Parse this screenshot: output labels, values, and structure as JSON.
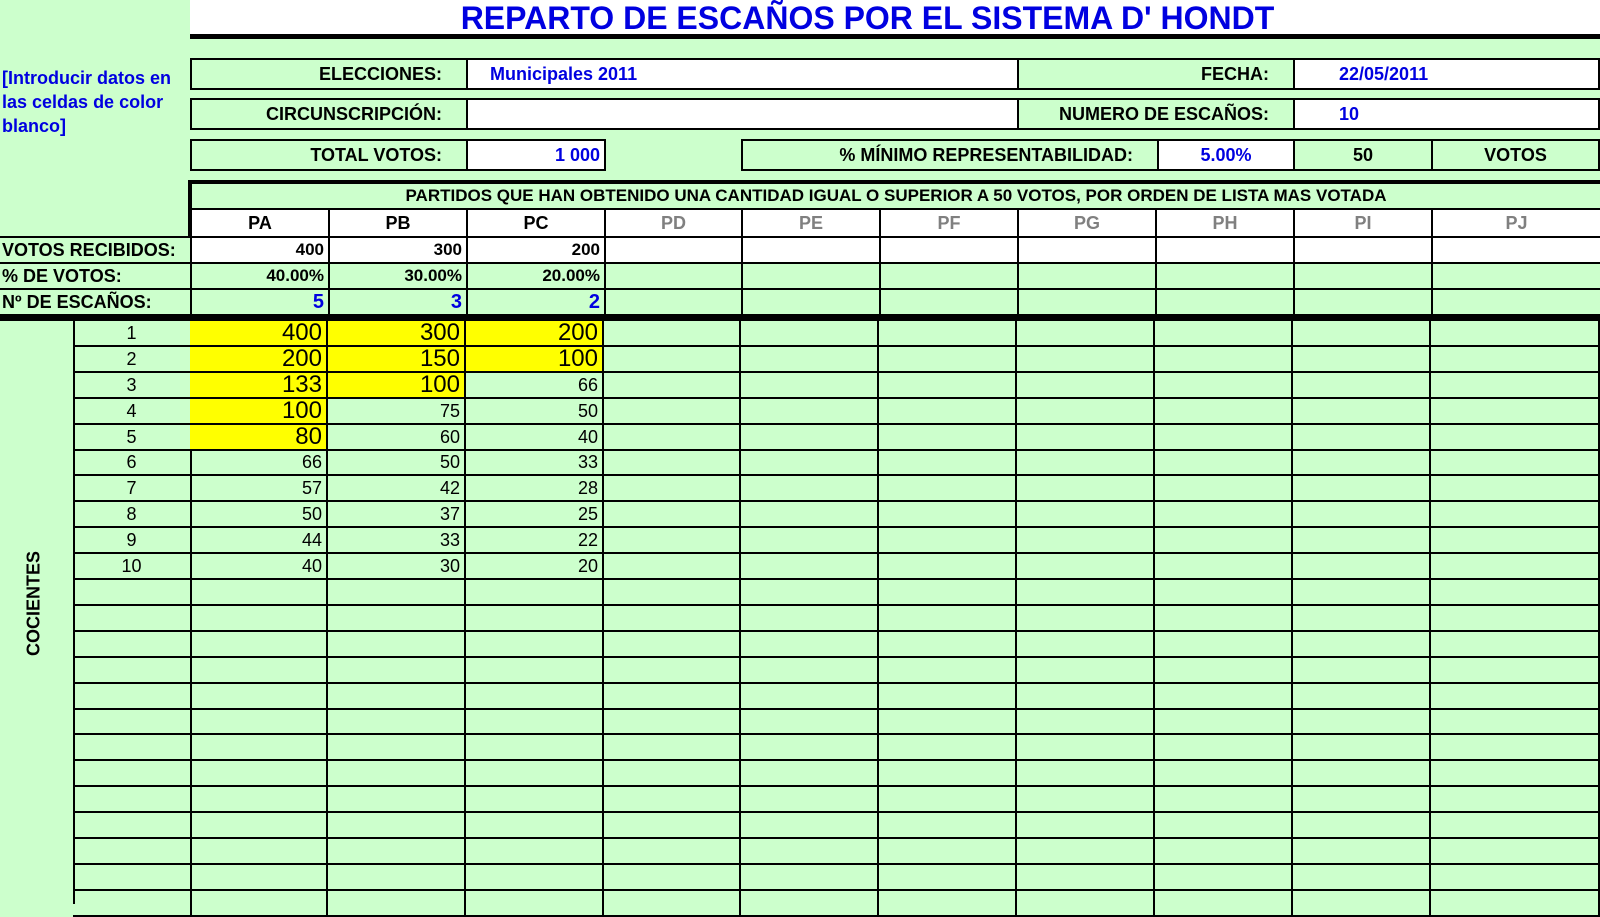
{
  "title": "REPARTO DE ESCAÑOS POR EL SISTEMA D' HONDT",
  "hint": "[Introducir datos en las celdas de color blanco]",
  "form": {
    "elecciones_label": "ELECCIONES:",
    "elecciones_value": "Municipales 2011",
    "fecha_label": "FECHA:",
    "fecha_value": "22/05/2011",
    "circunscripcion_label": "CIRCUNSCRIPCIÓN:",
    "circunscripcion_value": "",
    "escanos_label": "NUMERO DE ESCAÑOS:",
    "escanos_value": "10",
    "total_votos_label": "TOTAL VOTOS:",
    "total_votos_value": "1 000",
    "minimo_label": "% MÍNIMO REPRESENTABILIDAD:",
    "minimo_value": "5.00%",
    "minimo_votos": "50",
    "votos_unit": "VOTOS"
  },
  "parties_header": "PARTIDOS QUE HAN OBTENIDO UNA CANTIDAD IGUAL O SUPERIOR A 50 VOTOS, POR ORDEN DE LISTA MAS VOTADA",
  "parties": [
    "PA",
    "PB",
    "PC",
    "PD",
    "PE",
    "PF",
    "PG",
    "PH",
    "PI",
    "PJ"
  ],
  "active_parties": 3,
  "rows": {
    "votos_label": "VOTOS RECIBIDOS:",
    "pct_label": "% DE VOTOS:",
    "escanos_label": "Nº DE ESCAÑOS:",
    "votos": [
      "400",
      "300",
      "200"
    ],
    "pct": [
      "40.00%",
      "30.00%",
      "20.00%"
    ],
    "escanos": [
      "5",
      "3",
      "2"
    ]
  },
  "cocientes_label": "COCIENTES",
  "quotients": {
    "indices": [
      "1",
      "2",
      "3",
      "4",
      "5",
      "6",
      "7",
      "8",
      "9",
      "10"
    ],
    "values": [
      [
        "400",
        "300",
        "200"
      ],
      [
        "200",
        "150",
        "100"
      ],
      [
        "133",
        "100",
        "66"
      ],
      [
        "100",
        "75",
        "50"
      ],
      [
        "80",
        "60",
        "40"
      ],
      [
        "66",
        "50",
        "33"
      ],
      [
        "57",
        "42",
        "28"
      ],
      [
        "50",
        "37",
        "25"
      ],
      [
        "44",
        "33",
        "22"
      ],
      [
        "40",
        "30",
        "20"
      ]
    ],
    "highlighted": [
      [
        true,
        true,
        true
      ],
      [
        true,
        true,
        true
      ],
      [
        true,
        true,
        false
      ],
      [
        true,
        false,
        false
      ],
      [
        true,
        false,
        false
      ],
      [
        false,
        false,
        false
      ],
      [
        false,
        false,
        false
      ],
      [
        false,
        false,
        false
      ],
      [
        false,
        false,
        false
      ],
      [
        false,
        false,
        false
      ]
    ]
  },
  "colors": {
    "background": "#ccffcc",
    "accent_blue": "#0000e0",
    "highlight": "#ffff00",
    "inactive_party": "#808080"
  }
}
